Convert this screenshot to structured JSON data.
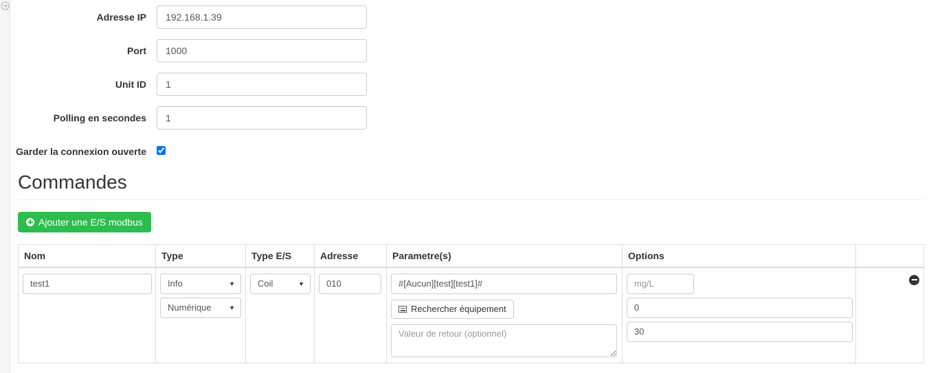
{
  "sidebar": {
    "toggle_icon": "arrow-circle-right-icon"
  },
  "form": {
    "fields": [
      {
        "label": "Adresse IP",
        "value": "192.168.1.39"
      },
      {
        "label": "Port",
        "value": "1000"
      },
      {
        "label": "Unit ID",
        "value": "1"
      },
      {
        "label": "Polling en secondes",
        "value": "1"
      }
    ],
    "keep_open": {
      "label": "Garder la connexion ouverte",
      "checked": true
    }
  },
  "commands": {
    "title": "Commandes",
    "add_button": {
      "label": "Ajouter une E/S modbus",
      "icon": "plus-circle-icon",
      "color": "#2dbc4e"
    },
    "table": {
      "headers": [
        "Nom",
        "Type",
        "Type E/S",
        "Adresse",
        "Parametre(s)",
        "Options",
        ""
      ],
      "rows": [
        {
          "nom": "test1",
          "type": "Info",
          "subtype": "Numérique",
          "type_es": "Coil",
          "adresse": "010",
          "parametre": "#[Aucun][test][test1]#",
          "search_button": {
            "label": "Rechercher équipement",
            "icon": "list-icon"
          },
          "retour_placeholder": "Valeur de retour (optionnel)",
          "retour_value": "",
          "options": {
            "unite_placeholder": "mg/L",
            "unite_value": "",
            "min": "0",
            "max": "30"
          },
          "delete_icon": "minus-circle-icon"
        }
      ]
    }
  }
}
